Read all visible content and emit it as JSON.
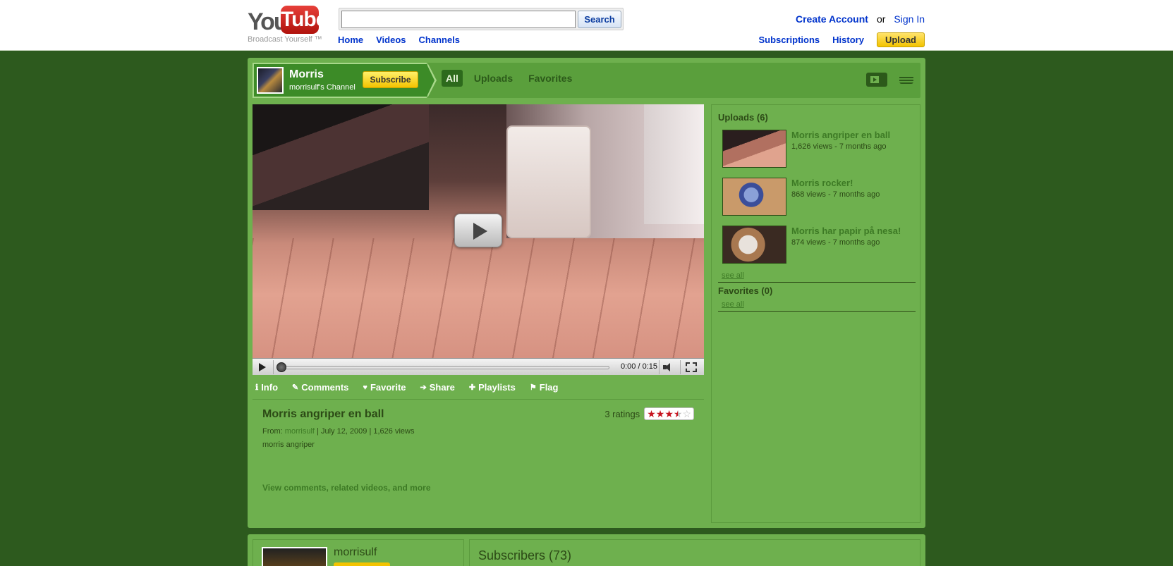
{
  "header": {
    "logo_you": "You",
    "logo_tube": "Tube",
    "tagline": "Broadcast Yourself ™",
    "search_placeholder": "",
    "search_button": "Search",
    "nav": [
      "Home",
      "Videos",
      "Channels"
    ],
    "create_account": "Create Account",
    "or": "or",
    "sign_in": "Sign In",
    "subscriptions": "Subscriptions",
    "history": "History",
    "upload": "Upload"
  },
  "channel": {
    "name": "Morris",
    "subtitle": "morrisulf's Channel",
    "subscribe": "Subscribe",
    "tabs": [
      "All",
      "Uploads",
      "Favorites"
    ],
    "active_tab": "All"
  },
  "player": {
    "time": "0:00 / 0:15",
    "progress": 0.0
  },
  "info_tabs": [
    {
      "icon": "ℹ",
      "label": "Info"
    },
    {
      "icon": "✎",
      "label": "Comments"
    },
    {
      "icon": "♥",
      "label": "Favorite"
    },
    {
      "icon": "➔",
      "label": "Share"
    },
    {
      "icon": "✚",
      "label": "Playlists"
    },
    {
      "icon": "⚑",
      "label": "Flag"
    }
  ],
  "video_info": {
    "title": "Morris angriper en ball",
    "from_label": "From:",
    "from_user": "morrisulf",
    "date": "July 12, 2009",
    "views": "1,626 views",
    "description": "morris angriper",
    "more_link": "View comments, related videos, and more",
    "ratings_label": "3 ratings",
    "rating": 3.5,
    "rating_max": 5
  },
  "sidebar": {
    "uploads_heading": "Uploads (6)",
    "uploads": [
      {
        "title": "Morris angriper en ball",
        "meta": "1,626 views - 7 months ago"
      },
      {
        "title": "Morris rocker!",
        "meta": "868 views - 7 months ago"
      },
      {
        "title": "Morris har papir på nesa!",
        "meta": "874 views - 7 months ago"
      }
    ],
    "see_all_uploads": "see all",
    "favorites_heading": "Favorites (0)",
    "see_all_favorites": "see all"
  },
  "bottom": {
    "profile_name": "morrisulf",
    "subscribers_title": "Subscribers (73)"
  },
  "colors": {
    "page_bg": "#2d5a1e",
    "channel_bg": "#6eb04e",
    "link_blue": "#0033cc",
    "accent_yellow": "#f3c300",
    "star_red": "#c6141f"
  }
}
